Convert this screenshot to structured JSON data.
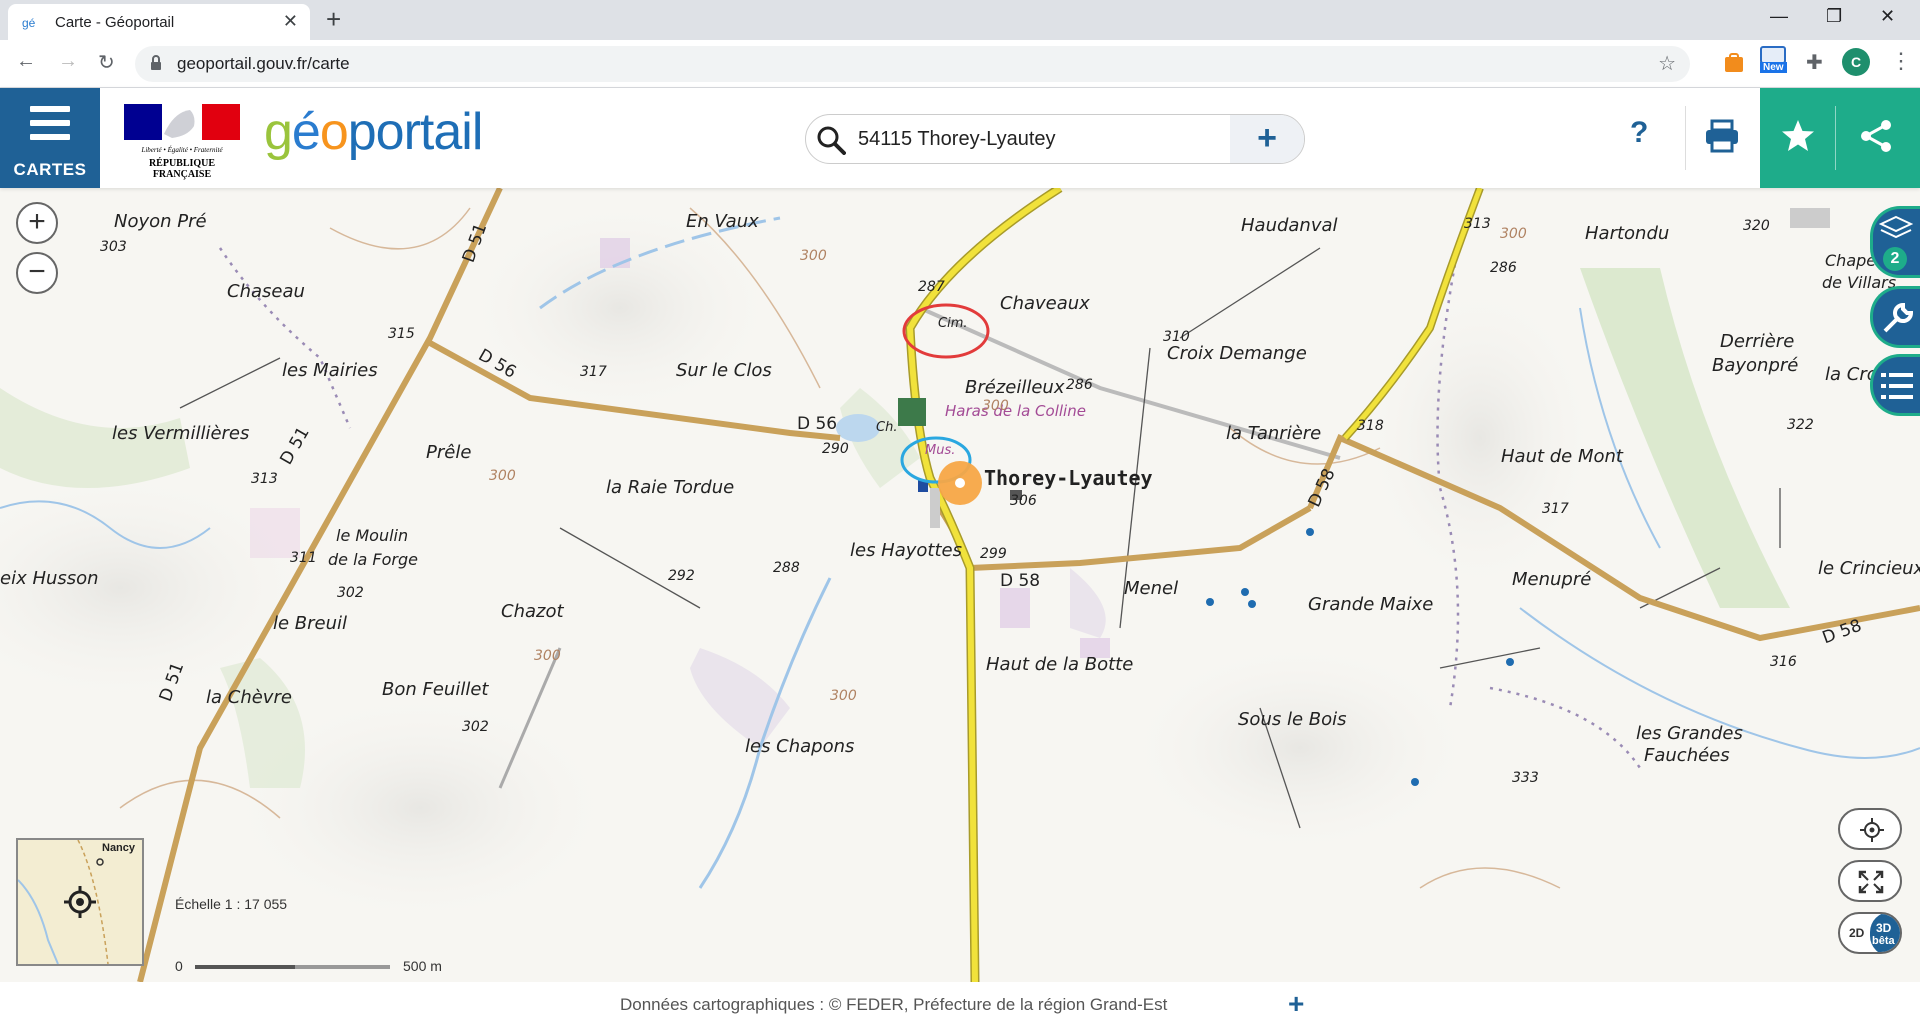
{
  "browser": {
    "tab_title": "Carte - Géoportail",
    "url": "geoportail.gouv.fr/carte",
    "ext_new_label": "New",
    "profile_initial": "C"
  },
  "header": {
    "menu_label": "CARTES",
    "republic_devise": "Liberté • Égalité • Fraternité",
    "republic_name": "RÉPUBLIQUE FRANÇAISE",
    "logo_parts": [
      "g",
      "é",
      "o",
      "portail"
    ],
    "search_value": "54115 Thorey-Lyautey",
    "help_label": "?"
  },
  "map": {
    "place_labels": [
      "Noyon Pré",
      "En Vaux",
      "Haudanval",
      "Hartondu",
      "Chaseau",
      "Chaveaux",
      "Chape",
      "de Villars",
      "Croix Demange",
      "Derrière",
      "Bayonpré",
      "Brézeilleux",
      "les Mairies",
      "Sur le Clos",
      "la Croisette",
      "Haras de la Colline",
      "les Vermillières",
      "la Tanrière",
      "Prêle",
      "Haut de Mont",
      "Thorey-Lyautey",
      "la Raie Tordue",
      "les Hayottes",
      "le Moulin",
      "de la Forge",
      "eix Husson",
      "le Crincieux",
      "Menel",
      "Menupré",
      "Grande Maixe",
      "Chazot",
      "le Breuil",
      "Haut de la Botte",
      "Bon Feuillet",
      "la Chèvre",
      "Sous le Bois",
      "les Grandes",
      "Fauchées",
      "les Chapons",
      "Cim.",
      "Ch.",
      "Mus.",
      "Nancy"
    ],
    "altitudes": [
      "286",
      "303",
      "320",
      "313",
      "286",
      "287",
      "315",
      "317",
      "310",
      "322",
      "318",
      "290",
      "306",
      "313",
      "299",
      "317",
      "288",
      "292",
      "311",
      "302",
      "316",
      "302",
      "333",
      "300",
      "300",
      "300",
      "300",
      "300",
      "300"
    ],
    "road_labels": [
      "D 51",
      "D 56",
      "D 56",
      "D 51",
      "D 58",
      "D 58",
      "D 58",
      "D 51"
    ],
    "layer_count": "2",
    "view_2d": "2D",
    "view_3d": "3D",
    "view_beta": "bêta",
    "scale_title": "Échelle 1 : 17 055",
    "scale_zero": "0",
    "scale_end": "500 m"
  },
  "footer": {
    "attribution": "Données cartographiques : ©    FEDER,  Préfecture de la région Grand-Est"
  },
  "colors": {
    "header_blue": "#1f6196",
    "share_green": "#1eac8a",
    "road_brown": "#c9a15a",
    "road_yellow": "#f1e23b",
    "highlight_red": "#e23b3b",
    "highlight_blue": "#2aa7e0",
    "marker_orange": "#f7a646"
  }
}
